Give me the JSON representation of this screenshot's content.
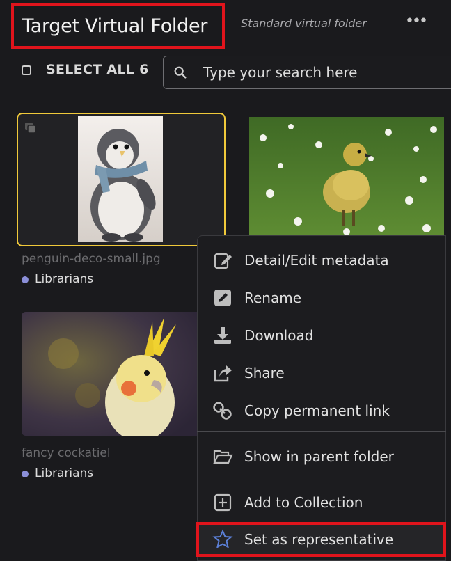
{
  "header": {
    "title": "Target Virtual Folder",
    "subtitle": "Standard virtual folder",
    "more_glyph": "•••"
  },
  "toolbar": {
    "select_all_label": "SELECT ALL 6",
    "search_placeholder": "Type your search here"
  },
  "items": [
    {
      "filename": "penguin-deco-small.jpg",
      "group": "Librarians",
      "selected": true,
      "image": "felt penguin ornament with scarf"
    },
    {
      "filename": "",
      "group": "",
      "image": "gosling on grass with daisies"
    },
    {
      "filename": "fancy cockatiel",
      "group": "Librarians",
      "image": "cockatiel with yellow crest"
    }
  ],
  "context_menu": {
    "items": [
      {
        "label": "Detail/Edit metadata",
        "icon": "edit-document-icon"
      },
      {
        "label": "Rename",
        "icon": "pencil-icon"
      },
      {
        "label": "Download",
        "icon": "download-icon"
      },
      {
        "label": "Share",
        "icon": "share-icon"
      },
      {
        "label": "Copy permanent link",
        "icon": "link-icon"
      },
      {
        "label": "Show in parent folder",
        "icon": "folder-open-icon"
      },
      {
        "label": "Add to Collection",
        "icon": "plus-square-icon"
      },
      {
        "label": "Set as representative",
        "icon": "star-icon"
      }
    ]
  },
  "colors": {
    "background": "#1a1a1d",
    "selection_border": "#f0c93a",
    "highlight_red": "#e0141c",
    "tag_dot": "#8b8fd8",
    "star": "#5b7fd6"
  }
}
